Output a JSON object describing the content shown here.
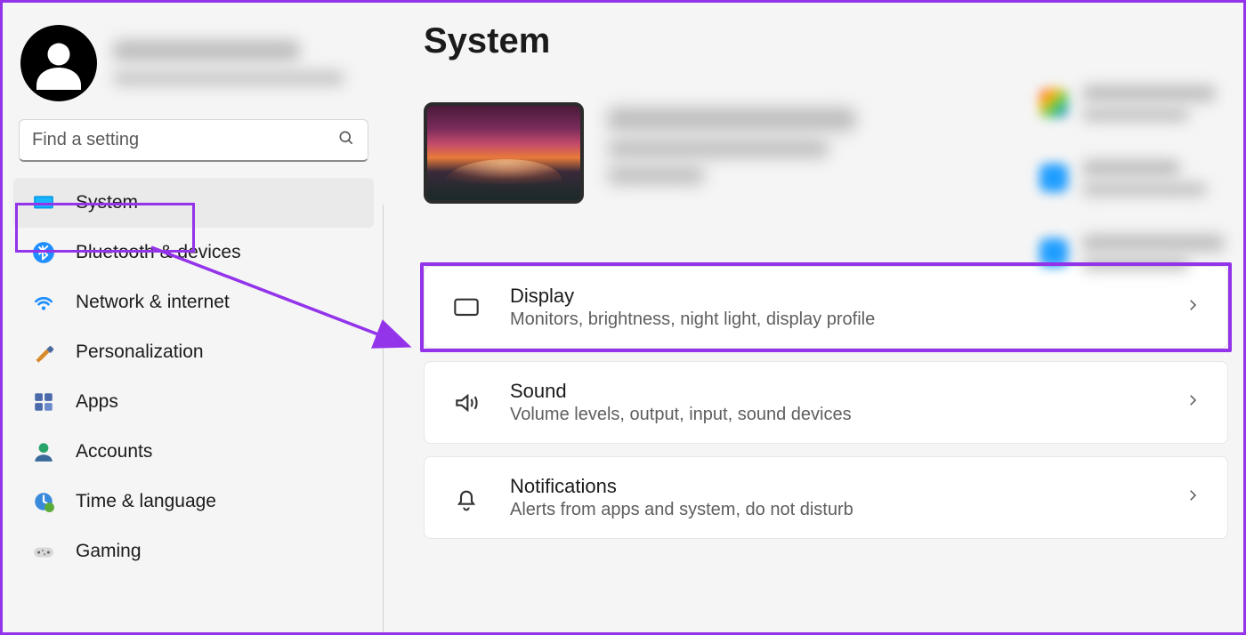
{
  "search": {
    "placeholder": "Find a setting"
  },
  "page_title": "System",
  "nav": [
    {
      "key": "system",
      "label": "System",
      "selected": true
    },
    {
      "key": "bluetooth",
      "label": "Bluetooth & devices",
      "selected": false
    },
    {
      "key": "network",
      "label": "Network & internet",
      "selected": false
    },
    {
      "key": "personalization",
      "label": "Personalization",
      "selected": false
    },
    {
      "key": "apps",
      "label": "Apps",
      "selected": false
    },
    {
      "key": "accounts",
      "label": "Accounts",
      "selected": false
    },
    {
      "key": "time",
      "label": "Time & language",
      "selected": false
    },
    {
      "key": "gaming",
      "label": "Gaming",
      "selected": false
    }
  ],
  "cards": {
    "display": {
      "title": "Display",
      "sub": "Monitors, brightness, night light, display profile"
    },
    "sound": {
      "title": "Sound",
      "sub": "Volume levels, output, input, sound devices"
    },
    "notifications": {
      "title": "Notifications",
      "sub": "Alerts from apps and system, do not disturb"
    }
  },
  "annotation": {
    "highlight_nav": "system",
    "highlight_card": "display"
  }
}
